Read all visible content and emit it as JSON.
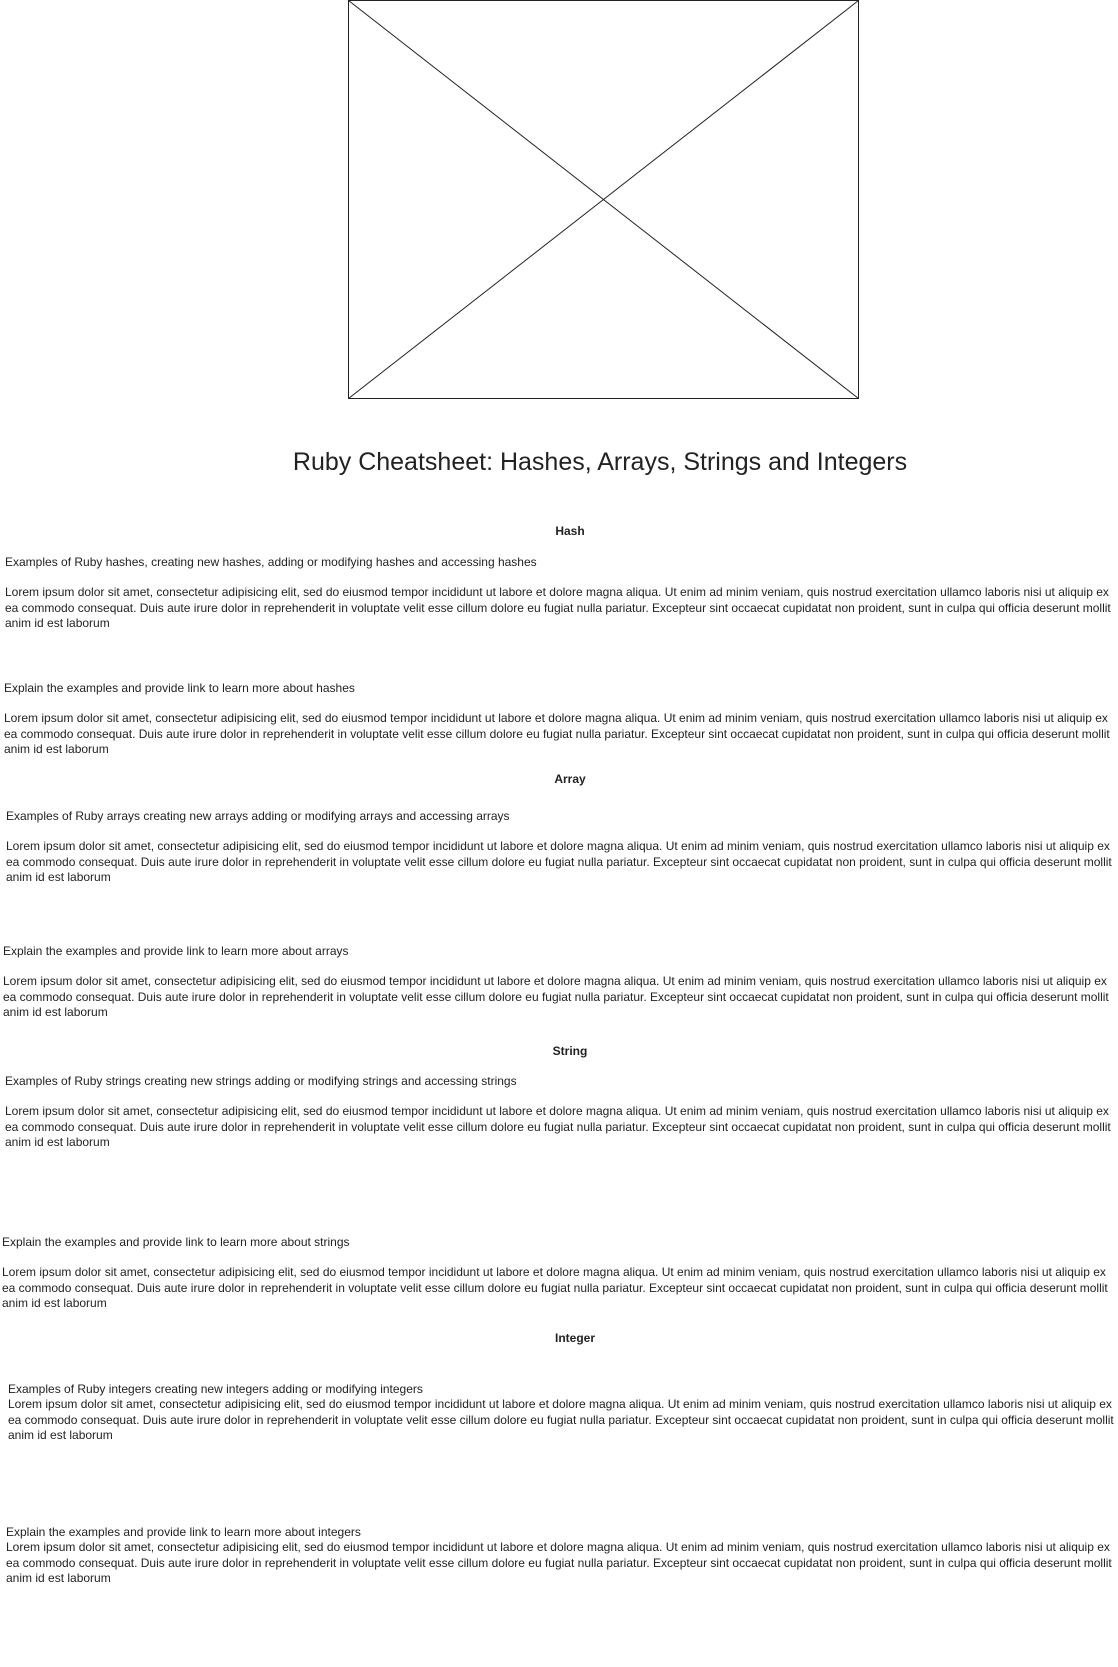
{
  "page": {
    "title": "Ruby Cheatsheet: Hashes, Arrays, Strings and Integers"
  },
  "image_placeholder": {
    "icon": "image-placeholder-icon"
  },
  "sections": [
    {
      "heading": "Hash",
      "examples_caption": "Examples of Ruby hashes, creating new hashes, adding or modifying hashes and accessing hashes",
      "examples_text": "Lorem ipsum dolor sit amet, consectetur adipisicing elit, sed do eiusmod tempor incididunt ut labore et dolore magna aliqua. Ut enim ad minim veniam, quis nostrud exercitation ullamco laboris nisi ut aliquip ex ea commodo consequat. Duis aute irure dolor in reprehenderit in voluptate velit esse cillum dolore eu fugiat nulla pariatur. Excepteur sint occaecat cupidatat non proident, sunt in culpa qui officia deserunt mollit anim id est laborum",
      "explain_caption": "Explain the examples and provide link to learn more about hashes",
      "explain_text": "Lorem ipsum dolor sit amet, consectetur adipisicing elit, sed do eiusmod tempor incididunt ut labore et dolore magna aliqua. Ut enim ad minim veniam, quis nostrud exercitation ullamco laboris nisi ut aliquip ex ea commodo consequat. Duis aute irure dolor in reprehenderit in voluptate velit esse cillum dolore eu fugiat nulla pariatur. Excepteur sint occaecat cupidatat non proident, sunt in culpa qui officia deserunt mollit anim id est laborum"
    },
    {
      "heading": "Array",
      "examples_caption": "Examples of Ruby arrays creating new arrays adding or modifying arrays and accessing arrays",
      "examples_text": "Lorem ipsum dolor sit amet, consectetur adipisicing elit, sed do eiusmod tempor incididunt ut labore et dolore magna aliqua. Ut enim ad minim veniam, quis nostrud exercitation ullamco laboris nisi ut aliquip ex ea commodo consequat. Duis aute irure dolor in reprehenderit in voluptate velit esse cillum dolore eu fugiat nulla pariatur. Excepteur sint occaecat cupidatat non proident, sunt in culpa qui officia deserunt mollit anim id est laborum",
      "explain_caption": "Explain the examples and provide link to learn more about arrays",
      "explain_text": "Lorem ipsum dolor sit amet, consectetur adipisicing elit, sed do eiusmod tempor incididunt ut labore et dolore magna aliqua. Ut enim ad minim veniam, quis nostrud exercitation ullamco laboris nisi ut aliquip ex ea commodo consequat. Duis aute irure dolor in reprehenderit in voluptate velit esse cillum dolore eu fugiat nulla pariatur. Excepteur sint occaecat cupidatat non proident, sunt in culpa qui officia deserunt mollit anim id est laborum"
    },
    {
      "heading": "String",
      "examples_caption": "Examples of Ruby strings creating new strings adding or modifying strings and accessing strings",
      "examples_text": "Lorem ipsum dolor sit amet, consectetur adipisicing elit, sed do eiusmod tempor incididunt ut labore et dolore magna aliqua. Ut enim ad minim veniam, quis nostrud exercitation ullamco laboris nisi ut aliquip ex ea commodo consequat. Duis aute irure dolor in reprehenderit in voluptate velit esse cillum dolore eu fugiat nulla pariatur. Excepteur sint occaecat cupidatat non proident, sunt in culpa qui officia deserunt mollit anim id est laborum",
      "explain_caption": "Explain the examples and provide link to learn more about strings",
      "explain_text": "Lorem ipsum dolor sit amet, consectetur adipisicing elit, sed do eiusmod tempor incididunt ut labore et dolore magna aliqua. Ut enim ad minim veniam, quis nostrud exercitation ullamco laboris nisi ut aliquip ex ea commodo consequat. Duis aute irure dolor in reprehenderit in voluptate velit esse cillum dolore eu fugiat nulla pariatur. Excepteur sint occaecat cupidatat non proident, sunt in culpa qui officia deserunt mollit anim id est laborum"
    },
    {
      "heading": "Integer",
      "examples_caption": "Examples of Ruby integers creating new integers adding or modifying integers",
      "examples_text": "Lorem ipsum dolor sit amet, consectetur adipisicing elit, sed do eiusmod tempor incididunt ut labore et dolore magna aliqua. Ut enim ad minim veniam, quis nostrud exercitation ullamco laboris nisi ut aliquip ex ea commodo consequat. Duis aute irure dolor in reprehenderit in voluptate velit esse cillum dolore eu fugiat nulla pariatur. Excepteur sint occaecat cupidatat non proident, sunt in culpa qui officia deserunt mollit anim id est laborum",
      "explain_caption": "Explain the examples and provide link to learn more about integers",
      "explain_text": "Lorem ipsum dolor sit amet, consectetur adipisicing elit, sed do eiusmod tempor incididunt ut labore et dolore magna aliqua. Ut enim ad minim veniam, quis nostrud exercitation ullamco laboris nisi ut aliquip ex ea commodo consequat. Duis aute irure dolor in reprehenderit in voluptate velit esse cillum dolore eu fugiat nulla pariatur. Excepteur sint occaecat cupidatat non proident, sunt in culpa qui officia deserunt mollit anim id est laborum"
    }
  ]
}
